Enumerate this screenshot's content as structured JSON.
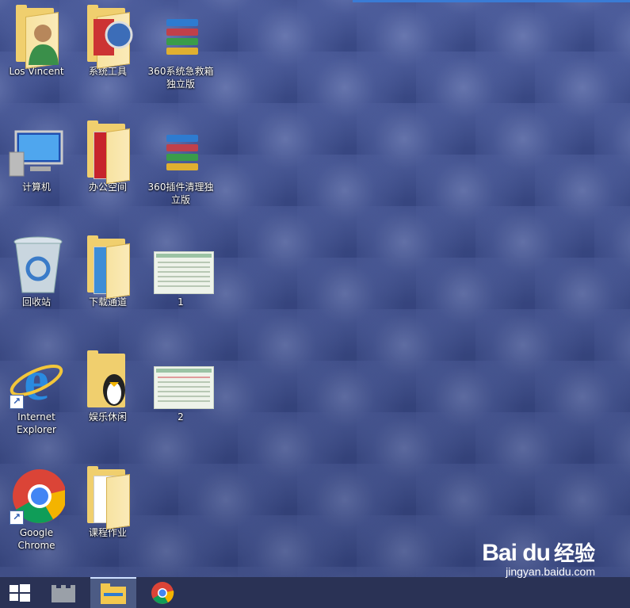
{
  "desktop_icons": {
    "los_vincent": "Los Vincent",
    "system_tools": "系统工具",
    "rescue_box": [
      "360系统急救箱",
      "独立版"
    ],
    "computer": "计算机",
    "office_space": "办公空间",
    "plugin_cleaner": [
      "360插件清理独",
      "立版"
    ],
    "recycle_bin": "回收站",
    "downloads": "下载通道",
    "image_1": "1",
    "ie": [
      "Internet",
      "Explorer"
    ],
    "entertainment": "娱乐休闲",
    "image_2": "2",
    "chrome": [
      "Google",
      "Chrome"
    ],
    "homework": "课程作业"
  },
  "watermark": {
    "logo": "Bai du",
    "cn": "经验",
    "url": "jingyan.baidu.com"
  },
  "colors": {
    "folder": "#f0cf6e",
    "taskbar": "#283050",
    "accent": "#3a7bd5"
  }
}
